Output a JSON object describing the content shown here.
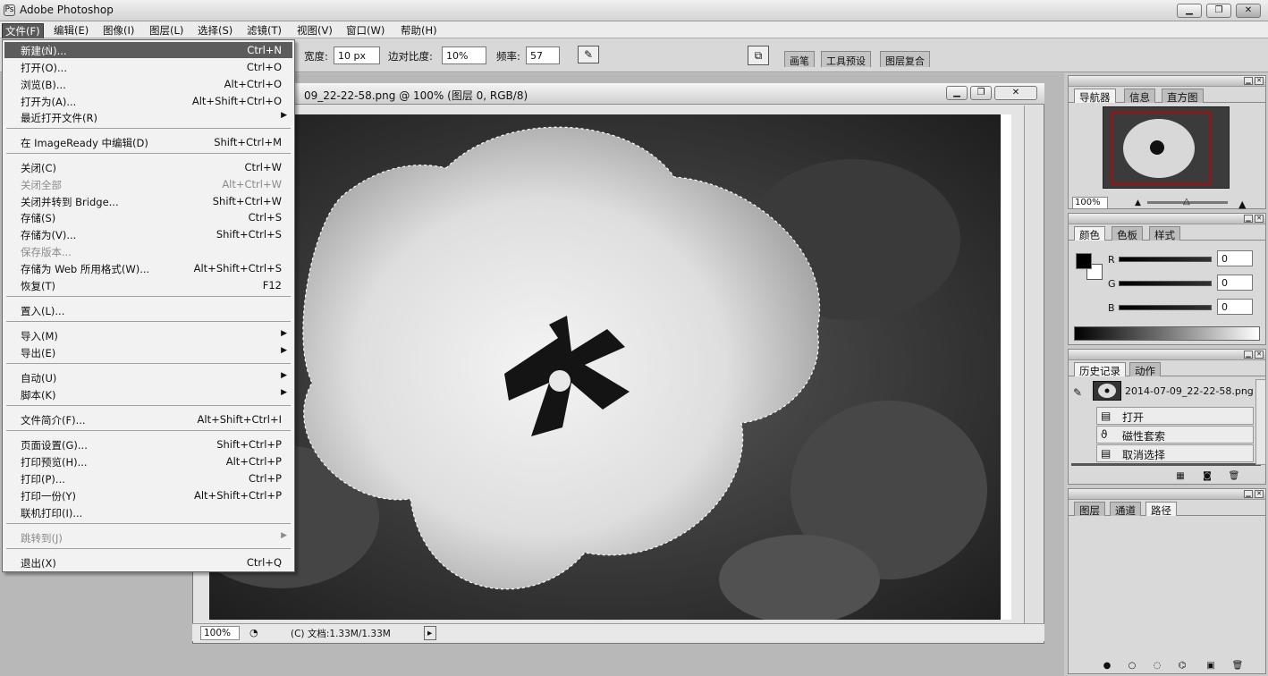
{
  "app": {
    "title": "Adobe Photoshop",
    "logo": "photoshop-icon"
  },
  "window_controls": {
    "minimize": "▁",
    "restore": "❐",
    "close": "✕"
  },
  "menubar": [
    "文件(F)",
    "编辑(E)",
    "图像(I)",
    "图层(L)",
    "选择(S)",
    "滤镜(T)",
    "视图(V)",
    "窗口(W)",
    "帮助(H)"
  ],
  "options": {
    "width_label": "宽度:",
    "width_value": "10 px",
    "contrast_label": "边对比度:",
    "contrast_value": "10%",
    "frequency_label": "频率:",
    "frequency_value": "57",
    "well_tabs": [
      "画笔",
      "工具预设",
      "图层复合"
    ]
  },
  "document": {
    "title": "09_22-22-58.png @ 100% (图层 0, RGB/8)",
    "zoom": "100%",
    "doc_size": "(C) 文档:1.33M/1.33M"
  },
  "file_menu": [
    {
      "label": "新建(N)...",
      "shortcut": "Ctrl+N",
      "highlight": true
    },
    {
      "label": "打开(O)...",
      "shortcut": "Ctrl+O"
    },
    {
      "label": "浏览(B)...",
      "shortcut": "Alt+Ctrl+O"
    },
    {
      "label": "打开为(A)...",
      "shortcut": "Alt+Shift+Ctrl+O"
    },
    {
      "label": "最近打开文件(R)",
      "shortcut": "",
      "submenu": true
    },
    {
      "label": "在 ImageReady 中编辑(D)",
      "shortcut": "Shift+Ctrl+M"
    },
    {
      "label": "关闭(C)",
      "shortcut": "Ctrl+W"
    },
    {
      "label": "关闭全部",
      "shortcut": "Alt+Ctrl+W",
      "disabled": true
    },
    {
      "label": "关闭并转到 Bridge...",
      "shortcut": "Shift+Ctrl+W"
    },
    {
      "label": "存储(S)",
      "shortcut": "Ctrl+S"
    },
    {
      "label": "存储为(V)...",
      "shortcut": "Shift+Ctrl+S"
    },
    {
      "label": "保存版本...",
      "shortcut": "",
      "disabled": true
    },
    {
      "label": "存储为 Web 所用格式(W)...",
      "shortcut": "Alt+Shift+Ctrl+S"
    },
    {
      "label": "恢复(T)",
      "shortcut": "F12"
    },
    {
      "label": "置入(L)...",
      "shortcut": ""
    },
    {
      "label": "导入(M)",
      "shortcut": "",
      "submenu": true
    },
    {
      "label": "导出(E)",
      "shortcut": "",
      "submenu": true
    },
    {
      "label": "自动(U)",
      "shortcut": "",
      "submenu": true
    },
    {
      "label": "脚本(K)",
      "shortcut": "",
      "submenu": true
    },
    {
      "label": "文件简介(F)...",
      "shortcut": "Alt+Shift+Ctrl+I"
    },
    {
      "label": "页面设置(G)...",
      "shortcut": "Shift+Ctrl+P"
    },
    {
      "label": "打印预览(H)...",
      "shortcut": "Alt+Ctrl+P"
    },
    {
      "label": "打印(P)...",
      "shortcut": "Ctrl+P"
    },
    {
      "label": "打印一份(Y)",
      "shortcut": "Alt+Shift+Ctrl+P"
    },
    {
      "label": "联机打印(I)...",
      "shortcut": ""
    },
    {
      "label": "跳转到(J)",
      "shortcut": "",
      "submenu": true,
      "disabled": true
    },
    {
      "label": "退出(X)",
      "shortcut": "Ctrl+Q"
    }
  ],
  "navigator": {
    "tabs": [
      "导航器",
      "信息",
      "直方图"
    ],
    "zoom": "100%"
  },
  "color": {
    "tabs": [
      "颜色",
      "色板",
      "样式"
    ],
    "r_label": "R",
    "g_label": "G",
    "b_label": "B",
    "r": "0",
    "g": "0",
    "b": "0"
  },
  "history": {
    "tabs": [
      "历史记录",
      "动作"
    ],
    "snapshot": "2014-07-09_22-22-58.png",
    "steps": [
      "打开",
      "磁性套索",
      "取消选择"
    ]
  },
  "layers": {
    "tabs": [
      "图层",
      "通道",
      "路径"
    ]
  }
}
